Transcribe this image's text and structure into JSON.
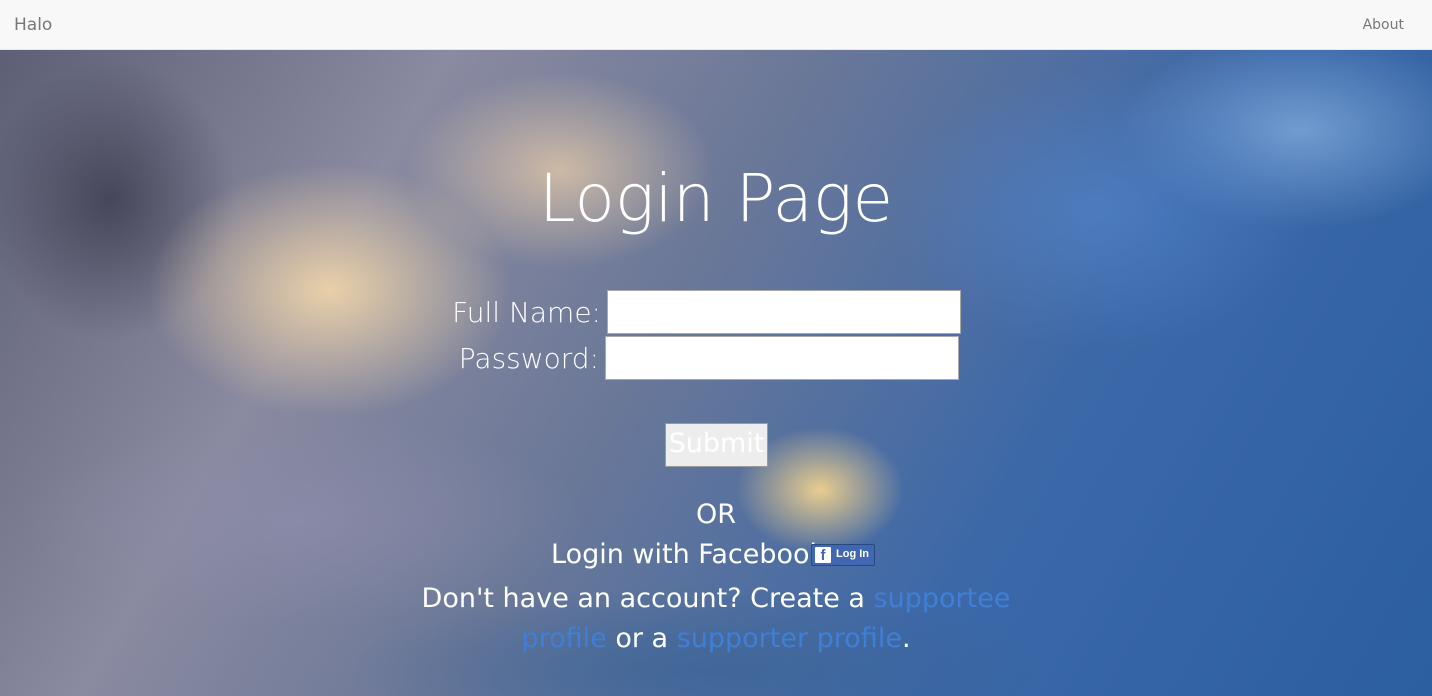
{
  "navbar": {
    "brand": "Halo",
    "about_link": "About"
  },
  "page": {
    "title": "Login Page"
  },
  "form": {
    "full_name_label": "Full Name:",
    "full_name_value": "",
    "password_label": "Password:",
    "password_value": "",
    "submit_label": "Submit"
  },
  "alt_login": {
    "or_text": "OR",
    "facebook_prompt": "Login with Facebook:",
    "facebook_button_label": "Log In",
    "facebook_icon": "facebook-f-icon"
  },
  "signup": {
    "prefix": "Don't have an account? Create a ",
    "link1": "supportee profile",
    "middle": " or a ",
    "link2": "supporter profile",
    "suffix": "."
  },
  "colors": {
    "navbar_bg": "#f8f8f8",
    "link_blue": "#3f7fd6",
    "facebook_blue": "#4267b2"
  }
}
